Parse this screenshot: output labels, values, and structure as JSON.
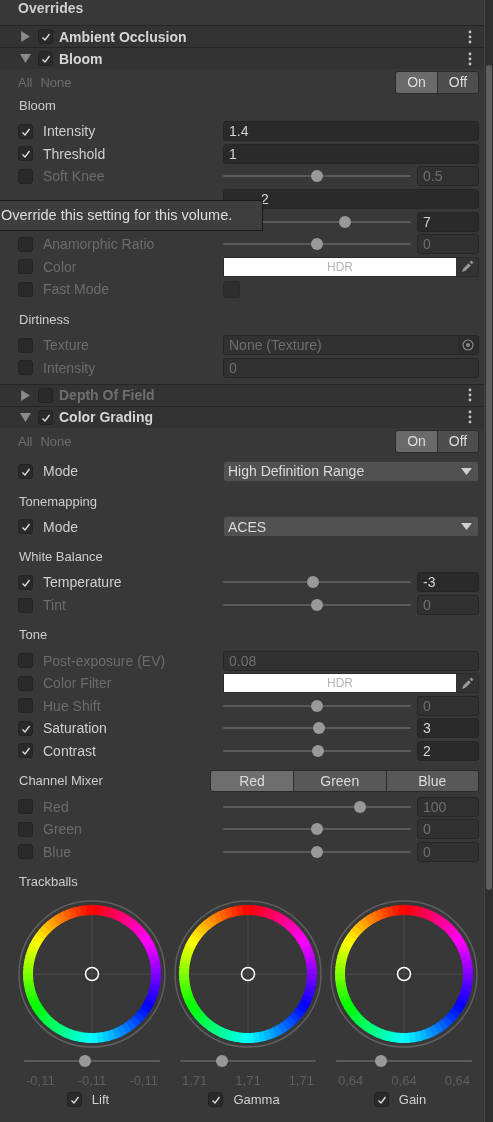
{
  "title": "Overrides",
  "sections": [
    {
      "title": "Ambient Occlusion",
      "expanded": false,
      "enabled": true
    },
    {
      "title": "Bloom",
      "expanded": true,
      "enabled": true,
      "links": [
        "All",
        "None"
      ],
      "switch": [
        {
          "label": "On",
          "selected": true
        },
        {
          "label": "Off",
          "selected": false
        }
      ],
      "groups": [
        {
          "heading": "Bloom",
          "rows": [
            {
              "kind": "field",
              "checked": true,
              "label": "Intensity",
              "value": "1.4"
            },
            {
              "kind": "field",
              "checked": true,
              "label": "Threshold",
              "value": "1"
            },
            {
              "kind": "slider",
              "checked": false,
              "label": "Soft Knee",
              "level": 0.5,
              "value": "0.5"
            },
            {
              "kind": "field",
              "value": "2"
            },
            {
              "kind": "slider",
              "level": 0.65,
              "value": "7"
            },
            {
              "kind": "slider",
              "checked": false,
              "label": "Anamorphic Ratio",
              "level": 0.5,
              "value": "0"
            },
            {
              "kind": "color",
              "checked": false,
              "label": "Color",
              "value": "HDR"
            },
            {
              "kind": "toggle",
              "checked": false,
              "label": "Fast Mode",
              "on": false
            }
          ]
        },
        {
          "heading": "Dirtiness",
          "rows": [
            {
              "kind": "object",
              "checked": false,
              "label": "Texture",
              "value": "None (Texture)"
            },
            {
              "kind": "field",
              "checked": false,
              "label": "Intensity",
              "value": "0"
            }
          ]
        }
      ]
    },
    {
      "title": "Depth Of Field",
      "expanded": false,
      "enabled": false
    },
    {
      "title": "Color Grading",
      "expanded": true,
      "enabled": true,
      "links": [
        "All",
        "None"
      ],
      "switch": [
        {
          "label": "On",
          "selected": true
        },
        {
          "label": "Off",
          "selected": false
        }
      ],
      "groups": [
        {
          "rows": [
            {
              "kind": "dropdown",
              "checked": true,
              "label": "Mode",
              "value": "High Definition Range"
            }
          ]
        },
        {
          "heading": "Tonemapping",
          "rows": [
            {
              "kind": "dropdown",
              "checked": true,
              "label": "Mode",
              "value": "ACES"
            }
          ]
        },
        {
          "heading": "White Balance",
          "rows": [
            {
              "kind": "slider",
              "checked": true,
              "label": "Temperature",
              "level": 0.48,
              "value": "-3"
            },
            {
              "kind": "slider",
              "checked": false,
              "label": "Tint",
              "level": 0.5,
              "value": "0"
            }
          ]
        },
        {
          "heading": "Tone",
          "rows": [
            {
              "kind": "field",
              "checked": false,
              "label": "Post-exposure (EV)",
              "value": "0.08"
            },
            {
              "kind": "color",
              "checked": false,
              "label": "Color Filter",
              "value": "HDR"
            },
            {
              "kind": "slider",
              "checked": false,
              "label": "Hue Shift",
              "level": 0.5,
              "value": "0"
            },
            {
              "kind": "slider",
              "checked": true,
              "label": "Saturation",
              "level": 0.51,
              "value": "3"
            },
            {
              "kind": "slider",
              "checked": true,
              "label": "Contrast",
              "level": 0.505,
              "value": "2"
            }
          ]
        },
        {
          "heading": "Channel Mixer",
          "tabs": [
            {
              "label": "Red",
              "selected": true
            },
            {
              "label": "Green",
              "selected": false
            },
            {
              "label": "Blue",
              "selected": false
            }
          ],
          "rows": [
            {
              "kind": "slider",
              "checked": false,
              "label": "Red",
              "level": 0.73,
              "value": "100"
            },
            {
              "kind": "slider",
              "checked": false,
              "label": "Green",
              "level": 0.5,
              "value": "0"
            },
            {
              "kind": "slider",
              "checked": false,
              "label": "Blue",
              "level": 0.5,
              "value": "0"
            }
          ]
        },
        {
          "heading": "Trackballs",
          "trackballs": [
            {
              "label": "Lift",
              "checked": true,
              "level": 0.45,
              "values": [
                "-0,11",
                "-0,11",
                "-0,11"
              ]
            },
            {
              "label": "Gamma",
              "checked": true,
              "level": 0.31,
              "values": [
                "1,71",
                "1,71",
                "1,71"
              ]
            },
            {
              "label": "Gain",
              "checked": true,
              "level": 0.33,
              "values": [
                "0,64",
                "0,64",
                "0,64"
              ]
            }
          ]
        }
      ]
    }
  ],
  "tooltip": "Override this setting for this volume."
}
